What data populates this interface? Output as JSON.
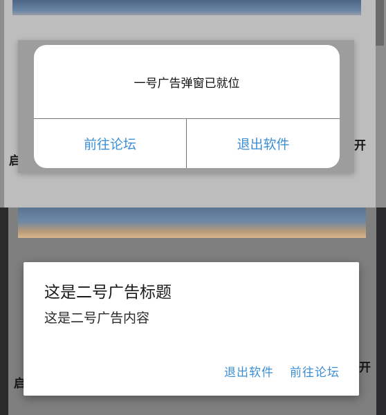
{
  "background": {
    "upper_left_text": "启",
    "upper_right_text": "开",
    "lower_left_text": "启",
    "lower_right_text": "开"
  },
  "dialog1": {
    "message": "一号广告弹窗已就位",
    "left_button": "前往论坛",
    "right_button": "退出软件"
  },
  "dialog2": {
    "title": "这是二号广告标题",
    "content": "这是二号广告内容",
    "exit_button": "退出软件",
    "forum_button": "前往论坛"
  },
  "colors": {
    "accent": "#3c8fd6",
    "scrim_upper": "#8e8e8e",
    "scrim_lower": "#2a2a2c"
  }
}
